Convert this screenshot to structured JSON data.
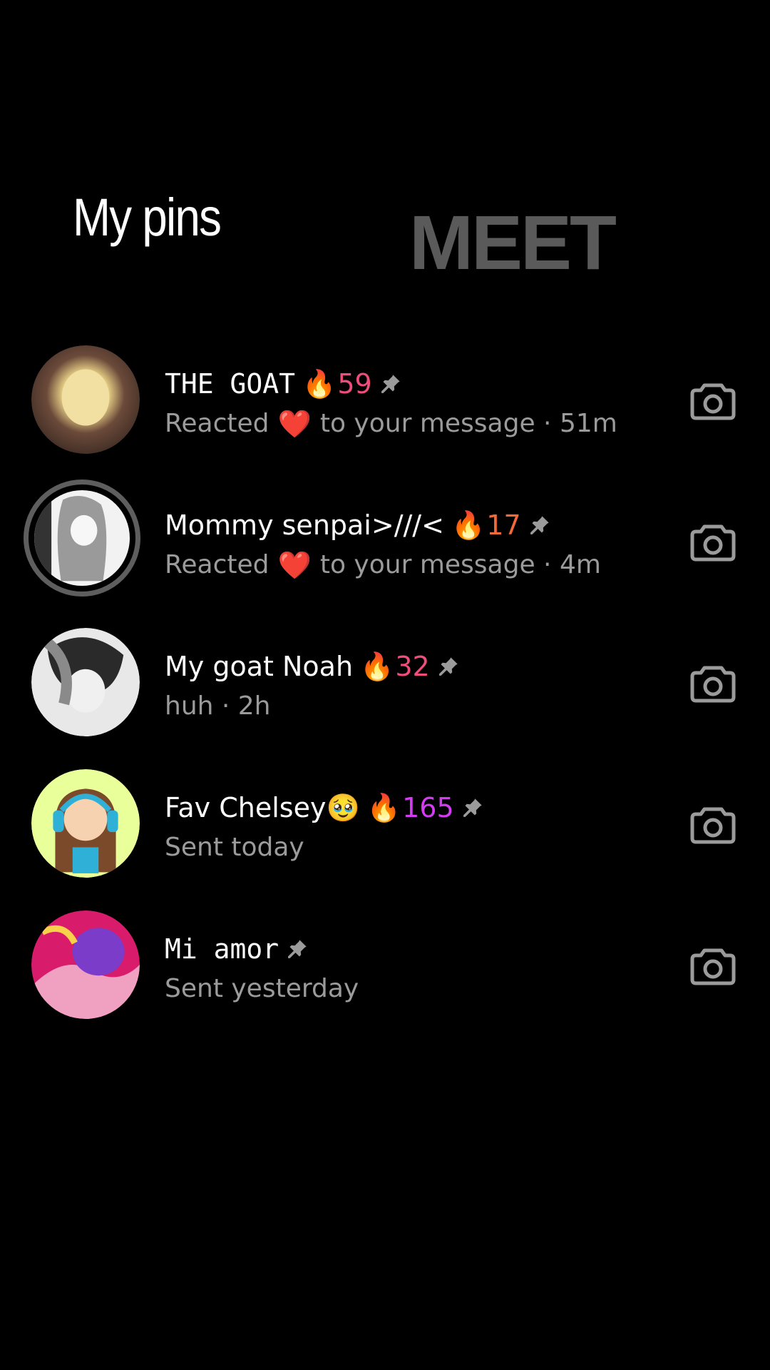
{
  "header": {
    "title": "My pins",
    "brand": "MEET"
  },
  "chats": [
    {
      "name": "THE GOAT",
      "name_style": "mono",
      "streak": "59",
      "streak_color": "#f04e7a",
      "flame_emoji": "🔥",
      "subtitle_prefix": "Reacted",
      "reaction": "❤️",
      "subtitle_suffix": "to your message · 51m",
      "avatar_colors": [
        "#f2e0a2",
        "#6b4a3a",
        "#3b2a22"
      ]
    },
    {
      "name": "Mommy senpai>///<",
      "name_style": "sans",
      "streak": "17",
      "streak_color": "#f26a3a",
      "flame_emoji": "🔥",
      "subtitle_prefix": "Reacted",
      "reaction": "❤️",
      "subtitle_suffix": "to your message · 4m",
      "avatar_colors": [
        "#f2f2f2",
        "#9a9a9a",
        "#333333"
      ]
    },
    {
      "name": "My goat Noah",
      "name_style": "sans",
      "streak": "32",
      "streak_color": "#f04e7a",
      "flame_emoji": "🔥",
      "subtitle_prefix": "huh · 2h",
      "reaction": "",
      "subtitle_suffix": "",
      "avatar_colors": [
        "#e8e8e8",
        "#8a8a8a",
        "#2a2a2a"
      ]
    },
    {
      "name": "Fav Chelsey🥹",
      "name_style": "sans",
      "streak": "165",
      "streak_color": "#d33cf0",
      "flame_emoji": "🔥",
      "subtitle_prefix": "Sent today",
      "reaction": "",
      "subtitle_suffix": "",
      "avatar_colors": [
        "#e9ff9a",
        "#7a4a2a",
        "#2fb0d6"
      ]
    },
    {
      "name": "Mi amor",
      "name_style": "mono",
      "streak": "",
      "streak_color": "",
      "flame_emoji": "",
      "subtitle_prefix": "Sent yesterday",
      "reaction": "",
      "subtitle_suffix": "",
      "avatar_colors": [
        "#d81b6a",
        "#7b3cc9",
        "#f0a0c0"
      ]
    }
  ],
  "icons": {
    "pin": "pin-icon",
    "camera": "camera-icon"
  },
  "colors": {
    "background": "#000000",
    "subtitle": "#9b9b9b",
    "brand": "#5a5a5a"
  }
}
